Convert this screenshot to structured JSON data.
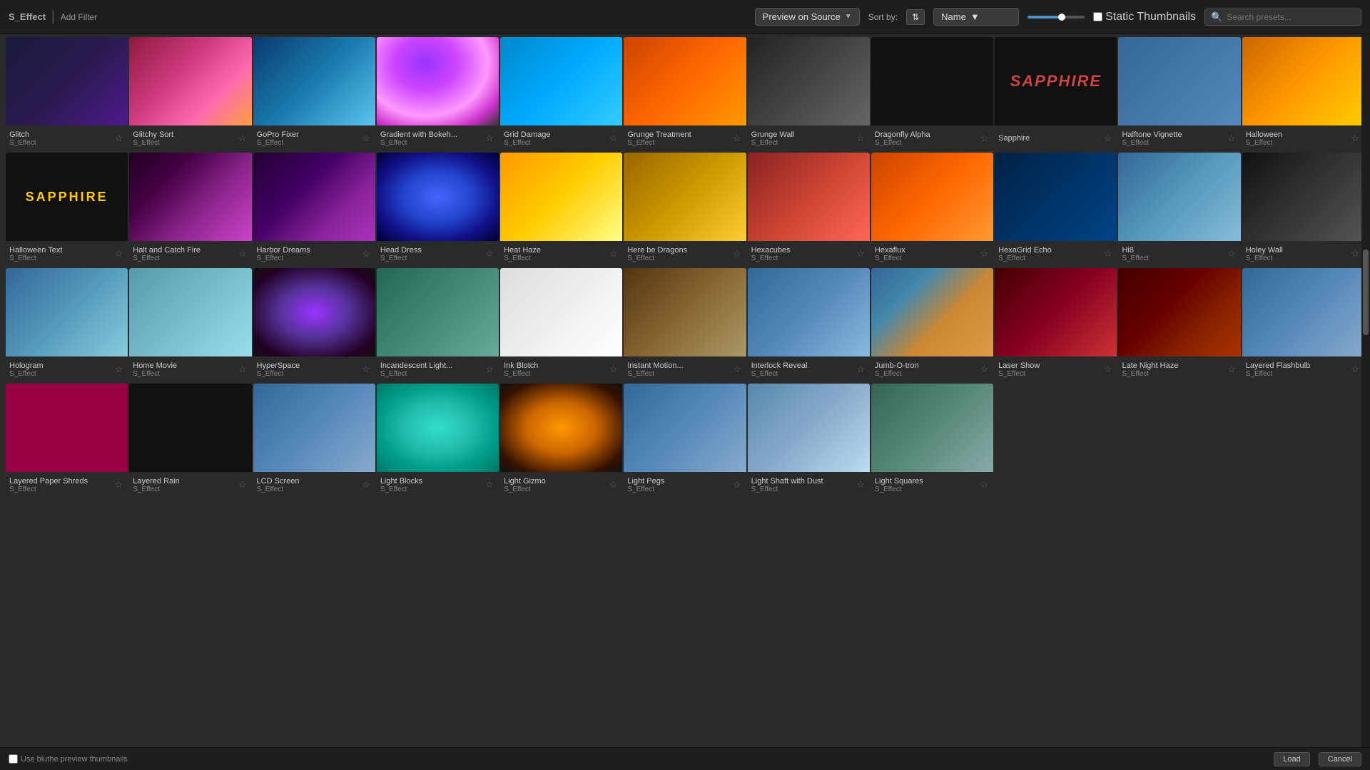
{
  "toolbar": {
    "brand": "S_Effect",
    "add_filter": "Add Filter",
    "preview_label": "Preview on Source",
    "sort_label": "Sort by:",
    "name_label": "Name",
    "static_thumb_label": "Static Thumbnails",
    "search_placeholder": "Search presets..."
  },
  "effects": [
    {
      "id": 1,
      "name": "Glitch",
      "type": "S_Effect",
      "thumb": "thumb-glitch",
      "row": 1,
      "col": 1
    },
    {
      "id": 2,
      "name": "Glitchy Sort",
      "type": "S_Effect",
      "thumb": "thumb-glitchy",
      "row": 1,
      "col": 2
    },
    {
      "id": 3,
      "name": "GoPro Fixer",
      "type": "S_Effect",
      "thumb": "thumb-gopro",
      "row": 1,
      "col": 3
    },
    {
      "id": 4,
      "name": "Gradient with Bokeh...",
      "type": "S_Effect",
      "thumb": "thumb-gradient",
      "row": 1,
      "col": 4
    },
    {
      "id": 5,
      "name": "Grid Damage",
      "type": "S_Effect",
      "thumb": "thumb-grid-damage",
      "row": 1,
      "col": 5
    },
    {
      "id": 6,
      "name": "Grunge Treatment",
      "type": "S_Effect",
      "thumb": "thumb-grunge",
      "row": 1,
      "col": 6
    },
    {
      "id": 7,
      "name": "Grunge Wall",
      "type": "S_Effect",
      "thumb": "thumb-grunge-wall",
      "row": 1,
      "col": 7
    },
    {
      "id": 8,
      "name": "Dragonfly Alpha",
      "type": "S_Effect",
      "thumb": "thumb-dragonfly",
      "row": 1,
      "col": 8
    },
    {
      "id": 9,
      "name": "Sapphire",
      "type": "",
      "thumb": "thumb-sapphire-card",
      "row": 1,
      "col": 9,
      "special": "sapphire-dark"
    },
    {
      "id": 10,
      "name": "Halftone Vignette",
      "type": "S_Effect",
      "thumb": "thumb-halftone",
      "row": 2,
      "col": 1
    },
    {
      "id": 11,
      "name": "Halloween",
      "type": "S_Effect",
      "thumb": "thumb-halloween",
      "row": 2,
      "col": 2
    },
    {
      "id": 12,
      "name": "Halloween Text",
      "type": "S_Effect",
      "thumb": "thumb-halloween-text",
      "row": 2,
      "col": 3,
      "special": "sapphire-yellow"
    },
    {
      "id": 13,
      "name": "Halt and Catch Fire",
      "type": "S_Effect",
      "thumb": "thumb-halt",
      "row": 2,
      "col": 4
    },
    {
      "id": 14,
      "name": "Harbor Dreams",
      "type": "S_Effect",
      "thumb": "thumb-harbor",
      "row": 2,
      "col": 5
    },
    {
      "id": 15,
      "name": "Head Dress",
      "type": "S_Effect",
      "thumb": "thumb-head-dress",
      "row": 2,
      "col": 6
    },
    {
      "id": 16,
      "name": "Heat Haze",
      "type": "S_Effect",
      "thumb": "thumb-heat-haze",
      "row": 2,
      "col": 7
    },
    {
      "id": 17,
      "name": "Here be Dragons",
      "type": "S_Effect",
      "thumb": "thumb-here-dragons",
      "row": 2,
      "col": 8
    },
    {
      "id": 18,
      "name": "Hexacubes",
      "type": "S_Effect",
      "thumb": "thumb-hexacubes",
      "row": 3,
      "col": 1
    },
    {
      "id": 19,
      "name": "Hexaflux",
      "type": "S_Effect",
      "thumb": "thumb-hexaflux",
      "row": 3,
      "col": 2
    },
    {
      "id": 20,
      "name": "HexaGrid Echo",
      "type": "S_Effect",
      "thumb": "thumb-hexagrid",
      "row": 3,
      "col": 3
    },
    {
      "id": 21,
      "name": "Hi8",
      "type": "S_Effect",
      "thumb": "thumb-hi8",
      "row": 3,
      "col": 4
    },
    {
      "id": 22,
      "name": "Holey Wall",
      "type": "S_Effect",
      "thumb": "thumb-holey-wall",
      "row": 3,
      "col": 5
    },
    {
      "id": 23,
      "name": "Hologram",
      "type": "S_Effect",
      "thumb": "thumb-hologram",
      "row": 3,
      "col": 6
    },
    {
      "id": 24,
      "name": "Home Movie",
      "type": "S_Effect",
      "thumb": "thumb-home-movie",
      "row": 3,
      "col": 7
    },
    {
      "id": 25,
      "name": "HyperSpace",
      "type": "S_Effect",
      "thumb": "thumb-hyperspace",
      "row": 3,
      "col": 8
    },
    {
      "id": 26,
      "name": "Incandescent Light...",
      "type": "S_Effect",
      "thumb": "thumb-incandescent",
      "row": 4,
      "col": 1
    },
    {
      "id": 27,
      "name": "Ink Blotch",
      "type": "S_Effect",
      "thumb": "thumb-ink-blotch",
      "row": 4,
      "col": 2
    },
    {
      "id": 28,
      "name": "Instant Motion...",
      "type": "S_Effect",
      "thumb": "thumb-instant",
      "row": 4,
      "col": 3
    },
    {
      "id": 29,
      "name": "Interlock Reveal",
      "type": "S_Effect",
      "thumb": "thumb-interlock",
      "row": 4,
      "col": 4
    },
    {
      "id": 30,
      "name": "Jumb-O-tron",
      "type": "S_Effect",
      "thumb": "thumb-jumb",
      "row": 4,
      "col": 5
    },
    {
      "id": 31,
      "name": "Laser Show",
      "type": "S_Effect",
      "thumb": "thumb-laser",
      "row": 4,
      "col": 6
    },
    {
      "id": 32,
      "name": "Late Night Haze",
      "type": "S_Effect",
      "thumb": "thumb-late",
      "row": 4,
      "col": 7
    },
    {
      "id": 33,
      "name": "Layered Flashbulb",
      "type": "S_Effect",
      "thumb": "thumb-layered-flash",
      "row": 4,
      "col": 8
    },
    {
      "id": 34,
      "name": "Layered Paper Shreds",
      "type": "S_Effect",
      "thumb": "thumb-layered-paper",
      "row": 5,
      "col": 1
    },
    {
      "id": 35,
      "name": "Layered Rain",
      "type": "S_Effect",
      "thumb": "thumb-layered-rain",
      "row": 5,
      "col": 2
    },
    {
      "id": 36,
      "name": "LCD Screen",
      "type": "S_Effect",
      "thumb": "thumb-lcd",
      "row": 5,
      "col": 3
    },
    {
      "id": 37,
      "name": "Light Blocks",
      "type": "S_Effect",
      "thumb": "thumb-light-blocks",
      "row": 5,
      "col": 4
    },
    {
      "id": 38,
      "name": "Light Gizmo",
      "type": "S_Effect",
      "thumb": "thumb-light-gizmo",
      "row": 5,
      "col": 5
    },
    {
      "id": 39,
      "name": "Light Pegs",
      "type": "S_Effect",
      "thumb": "thumb-light-pegs",
      "row": 5,
      "col": 6
    },
    {
      "id": 40,
      "name": "Light Shaft with Dust",
      "type": "S_Effect",
      "thumb": "thumb-light-shaft",
      "row": 5,
      "col": 7
    },
    {
      "id": 41,
      "name": "Light Squares",
      "type": "S_Effect",
      "thumb": "thumb-light-squares",
      "row": 5,
      "col": 8
    }
  ],
  "bottom_bar": {
    "checkbox_label": "Use bluthe preview thumbnails",
    "load_btn": "Load",
    "cancel_btn": "Cancel"
  }
}
